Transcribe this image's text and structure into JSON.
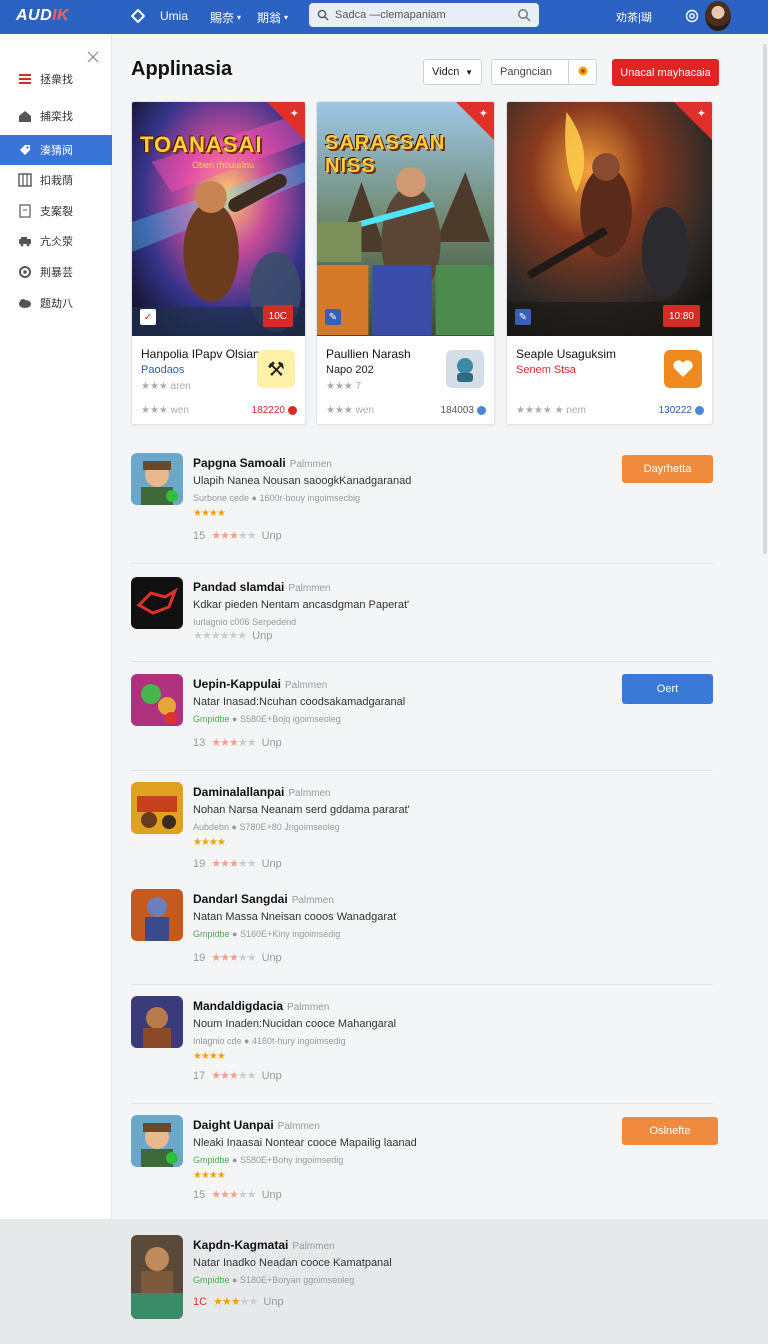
{
  "topbar": {
    "logo_main": "AUD",
    "logo_accent": "IK",
    "nav": [
      {
        "label": "Umia",
        "caret": ""
      },
      {
        "label": "賜奈",
        "caret": "▾"
      },
      {
        "label": "期翁",
        "caret": "▾"
      }
    ],
    "search_placeholder": "Sadca —clemapaniam",
    "right_text": "劝茶|瑚",
    "colors": {
      "bar": "#2c63c2",
      "accent": "#e02424"
    }
  },
  "sidebar": {
    "items": [
      {
        "label": "拯衆找",
        "icon": "menu-icon"
      },
      {
        "label": "捕栾找",
        "icon": "home-icon"
      },
      {
        "label": "湊猜阋",
        "icon": "tag-icon",
        "active": true
      },
      {
        "label": "扣栽荫",
        "icon": "grid-icon"
      },
      {
        "label": "支案裂",
        "icon": "doc-icon"
      },
      {
        "label": "亢仌荥",
        "icon": "car-icon"
      },
      {
        "label": "荆暴芸",
        "icon": "settings-icon"
      },
      {
        "label": "题劫八",
        "icon": "cloud-icon"
      }
    ]
  },
  "header": {
    "title": "Applinasia",
    "select_value": "Vidcn",
    "field_placeholder": "Pangncian",
    "primary_button": "Unacal mayhacaia"
  },
  "featured": [
    {
      "art_title": "TOANASAI",
      "sub_art": "Oben rhcuurlnu",
      "badge": "10C",
      "title": "Hanpolia IPapv Olsian",
      "subtitle": "Paodaos",
      "subtitle_color": "#2a5db0",
      "rating": "★★★ aren",
      "foot": "★★★ wen",
      "num": "182220",
      "num_color": "#d42b27"
    },
    {
      "art_title": "SARASSAN NISS",
      "sub_art": "",
      "badge": "",
      "title": "Paullien Narash",
      "subtitle": "Napo 202",
      "subtitle_color": "#222",
      "rating": "★★★ 7",
      "foot": "★★★ wen",
      "num": "184003",
      "num_color": "#555"
    },
    {
      "art_title": "",
      "sub_art": "",
      "badge": "10:80",
      "title": "Seaple Usaguksim",
      "subtitle": "Senem Stsa",
      "subtitle_color": "#d42b27",
      "rating": "",
      "foot": "★★★★ ★ nem",
      "num": "130222",
      "num_color": "#2a5db0"
    }
  ],
  "list": [
    {
      "title": "Papgna Samoali",
      "tag": "Palmmen",
      "desc": "Ulapih Nanea  Nousan saoogkKanadgaranad",
      "meta_left": "Surbone cede",
      "meta_right": "1600r-bouy ingoimsecbig",
      "stars": "★★★★",
      "rating_num": "15",
      "foot": "Unp",
      "action": "Dayrhetta",
      "action_color": "orange"
    },
    {
      "title": "Pandad slamdai",
      "tag": "Palmmen",
      "desc": "Kdkar pieden  Nentam ancasdgman Paperat'",
      "meta_left": "Iurlagnio c006",
      "meta_right": "Serpedend",
      "stars": "",
      "rating_num": "",
      "foot": "Unp",
      "action": "",
      "action_color": ""
    },
    {
      "title": "Uepin-Kappulai",
      "tag": "Palmmen",
      "desc": "Natar Inasad:Ncuhan coodsakamadgaranal",
      "meta_left": "Gmpidbe",
      "meta_right": "S580E+Bojq igoimseoleg",
      "stars": "",
      "rating_num": "13",
      "foot": "Unp",
      "action": "Oert",
      "action_color": "blue"
    },
    {
      "title": "Daminalallanpai",
      "tag": "Palmmen",
      "desc": "Nohan Narsa  Neanam serd gddama pararat'",
      "meta_left": "Aubdebn",
      "meta_right": "S780E+80 Jrigoimseoleg",
      "stars": "★★★★",
      "rating_num": "19",
      "foot": "Unp",
      "action": "",
      "action_color": ""
    },
    {
      "title": "Dandarl Sangdai",
      "tag": "Palmmen",
      "desc": "Natan Massa  Nneisan cooos Wanadgarat",
      "meta_left": "Gmpidbe",
      "meta_right": "S160E+Kiny ingoimsedig",
      "stars": "",
      "rating_num": "19",
      "foot": "Unp",
      "action": "",
      "action_color": ""
    },
    {
      "title": "Mandaldigdacia",
      "tag": "Palmmen",
      "desc": "Noum Inaden:Nucidan cooce Mahangaral",
      "meta_left": "Inlagnio cde",
      "meta_right": "4160t-hury ingoimsedig",
      "stars": "★★★★",
      "rating_num": "17",
      "foot": "Unp",
      "action": "",
      "action_color": ""
    },
    {
      "title": "Daight Uanpai",
      "tag": "Palmmen",
      "desc": "Nleaki Inaasai Nontear cooce Mapailig laanad",
      "meta_left": "Gmpidbe",
      "meta_right": "S580E+Bohy ingoimsedig",
      "stars": "★★★★",
      "rating_num": "15",
      "foot": "Unp",
      "action": "Oslnefte",
      "action_color": "orange"
    },
    {
      "title": "Kapdn-Kagmatai",
      "tag": "Palmmen",
      "desc": "Natar Inadko  Neadan cooce Kamatpanal",
      "meta_left": "Gmpidbe",
      "meta_right": "S180E+Boryan ggoimseoleg",
      "stars": "",
      "rating_num": "1C",
      "foot": "Unp",
      "action": "",
      "action_color": ""
    }
  ]
}
